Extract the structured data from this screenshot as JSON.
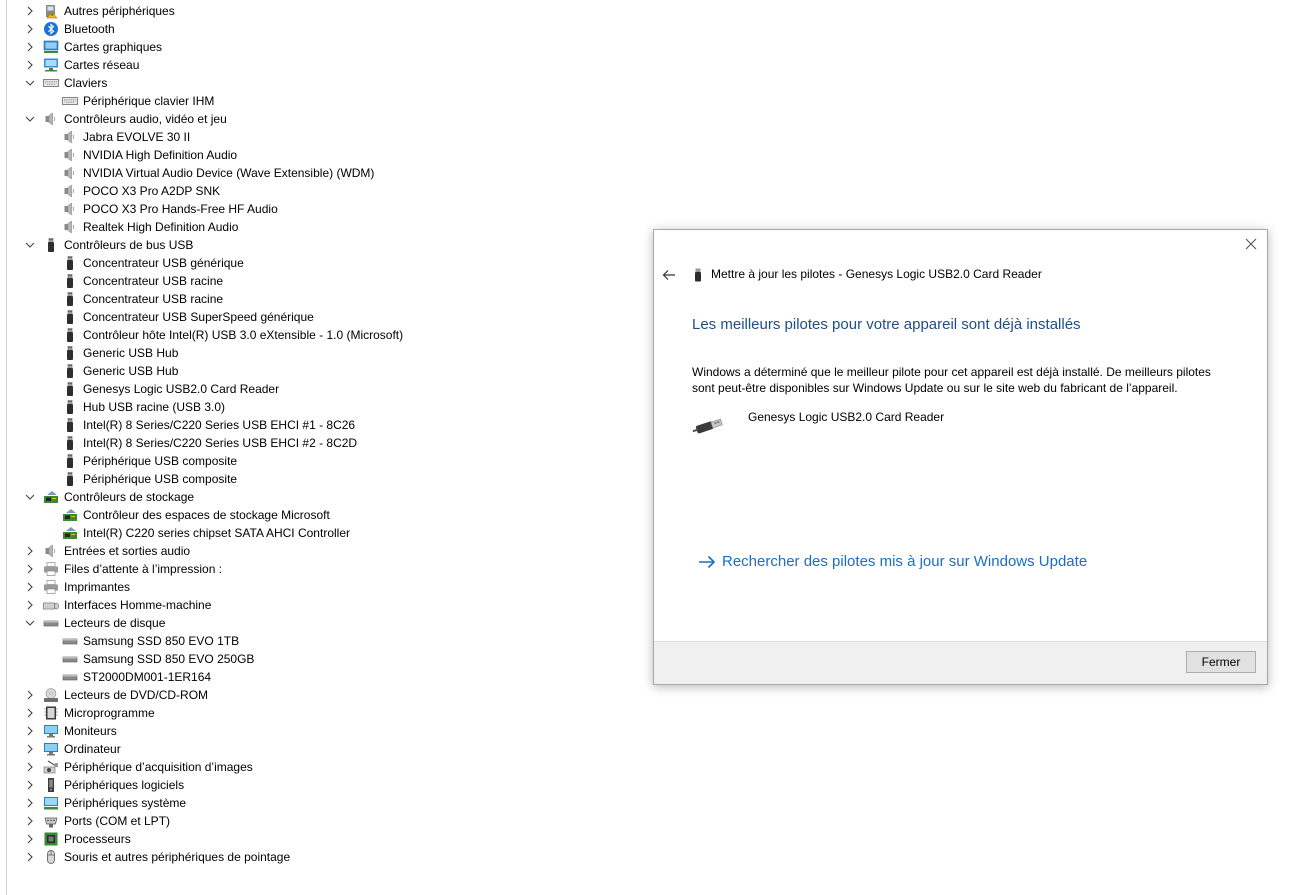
{
  "tree": [
    {
      "label": "Autres périphériques",
      "type": "cat",
      "expanded": false,
      "icon": "warning-device-icon"
    },
    {
      "label": "Bluetooth",
      "type": "cat",
      "expanded": false,
      "icon": "bluetooth-icon"
    },
    {
      "label": "Cartes graphiques",
      "type": "cat",
      "expanded": false,
      "icon": "display-adapter-icon"
    },
    {
      "label": "Cartes réseau",
      "type": "cat",
      "expanded": false,
      "icon": "network-adapter-icon"
    },
    {
      "label": "Claviers",
      "type": "cat",
      "expanded": true,
      "icon": "keyboard-icon"
    },
    {
      "label": "Périphérique clavier IHM",
      "type": "child",
      "icon": "keyboard-icon"
    },
    {
      "label": "Contrôleurs audio, vidéo et jeu",
      "type": "cat",
      "expanded": true,
      "icon": "speaker-icon"
    },
    {
      "label": "Jabra EVOLVE 30 II",
      "type": "child",
      "icon": "speaker-icon"
    },
    {
      "label": "NVIDIA High Definition Audio",
      "type": "child",
      "icon": "speaker-icon"
    },
    {
      "label": "NVIDIA Virtual Audio Device (Wave Extensible) (WDM)",
      "type": "child",
      "icon": "speaker-icon"
    },
    {
      "label": "POCO X3 Pro A2DP SNK",
      "type": "child",
      "icon": "speaker-icon"
    },
    {
      "label": "POCO X3 Pro Hands-Free HF Audio",
      "type": "child",
      "icon": "speaker-icon"
    },
    {
      "label": "Realtek High Definition Audio",
      "type": "child",
      "icon": "speaker-icon"
    },
    {
      "label": "Contrôleurs de bus USB",
      "type": "cat",
      "expanded": true,
      "icon": "usb-icon"
    },
    {
      "label": "Concentrateur USB générique",
      "type": "child",
      "icon": "usb-icon"
    },
    {
      "label": "Concentrateur USB racine",
      "type": "child",
      "icon": "usb-icon"
    },
    {
      "label": "Concentrateur USB racine",
      "type": "child",
      "icon": "usb-icon"
    },
    {
      "label": "Concentrateur USB SuperSpeed générique",
      "type": "child",
      "icon": "usb-icon"
    },
    {
      "label": "Contrôleur hôte Intel(R) USB 3.0 eXtensible - 1.0 (Microsoft)",
      "type": "child",
      "icon": "usb-icon"
    },
    {
      "label": "Generic USB Hub",
      "type": "child",
      "icon": "usb-icon"
    },
    {
      "label": "Generic USB Hub",
      "type": "child",
      "icon": "usb-icon"
    },
    {
      "label": "Genesys Logic USB2.0 Card Reader",
      "type": "child",
      "icon": "usb-icon"
    },
    {
      "label": "Hub USB racine (USB 3.0)",
      "type": "child",
      "icon": "usb-icon"
    },
    {
      "label": "Intel(R) 8 Series/C220 Series USB EHCI #1 - 8C26",
      "type": "child",
      "icon": "usb-icon"
    },
    {
      "label": "Intel(R) 8 Series/C220 Series USB EHCI #2 - 8C2D",
      "type": "child",
      "icon": "usb-icon"
    },
    {
      "label": "Périphérique USB composite",
      "type": "child",
      "icon": "usb-icon"
    },
    {
      "label": "Périphérique USB composite",
      "type": "child",
      "icon": "usb-icon"
    },
    {
      "label": "Contrôleurs de stockage",
      "type": "cat",
      "expanded": true,
      "icon": "storage-controller-icon"
    },
    {
      "label": "Contrôleur des espaces de stockage Microsoft",
      "type": "child",
      "icon": "storage-controller-icon"
    },
    {
      "label": "Intel(R) C220 series chipset SATA AHCI Controller",
      "type": "child",
      "icon": "storage-controller-icon"
    },
    {
      "label": "Entrées et sorties audio",
      "type": "cat",
      "expanded": false,
      "icon": "speaker-icon"
    },
    {
      "label": "Files d’attente à l’impression :",
      "type": "cat",
      "expanded": false,
      "icon": "printer-icon"
    },
    {
      "label": "Imprimantes",
      "type": "cat",
      "expanded": false,
      "icon": "printer-icon"
    },
    {
      "label": "Interfaces Homme-machine",
      "type": "cat",
      "expanded": false,
      "icon": "hid-icon"
    },
    {
      "label": "Lecteurs de disque",
      "type": "cat",
      "expanded": true,
      "icon": "disk-drive-icon"
    },
    {
      "label": "Samsung SSD 850 EVO 1TB",
      "type": "child",
      "icon": "disk-drive-icon"
    },
    {
      "label": "Samsung SSD 850 EVO 250GB",
      "type": "child",
      "icon": "disk-drive-icon"
    },
    {
      "label": "ST2000DM001-1ER164",
      "type": "child",
      "icon": "disk-drive-icon"
    },
    {
      "label": "Lecteurs de DVD/CD-ROM",
      "type": "cat",
      "expanded": false,
      "icon": "dvd-drive-icon"
    },
    {
      "label": "Microprogramme",
      "type": "cat",
      "expanded": false,
      "icon": "firmware-icon"
    },
    {
      "label": "Moniteurs",
      "type": "cat",
      "expanded": false,
      "icon": "monitor-icon"
    },
    {
      "label": "Ordinateur",
      "type": "cat",
      "expanded": false,
      "icon": "monitor-icon"
    },
    {
      "label": "Périphérique d’acquisition d’images",
      "type": "cat",
      "expanded": false,
      "icon": "camera-icon"
    },
    {
      "label": "Périphériques logiciels",
      "type": "cat",
      "expanded": false,
      "icon": "software-device-icon"
    },
    {
      "label": "Périphériques système",
      "type": "cat",
      "expanded": false,
      "icon": "system-device-icon"
    },
    {
      "label": "Ports (COM et LPT)",
      "type": "cat",
      "expanded": false,
      "icon": "port-icon"
    },
    {
      "label": "Processeurs",
      "type": "cat",
      "expanded": false,
      "icon": "processor-icon"
    },
    {
      "label": "Souris et autres périphériques de pointage",
      "type": "cat",
      "expanded": false,
      "icon": "mouse-icon"
    }
  ],
  "dialog": {
    "title": "Mettre à jour les pilotes - Genesys Logic USB2.0 Card Reader",
    "heading": "Les meilleurs pilotes pour votre appareil sont déjà installés",
    "description": "Windows a déterminé que le meilleur pilote pour cet appareil est déjà installé. De meilleurs pilotes sont peut-être disponibles sur Windows Update ou sur le site web du fabricant de l’appareil.",
    "device_name": "Genesys Logic USB2.0 Card Reader",
    "link_text": "Rechercher des pilotes mis à jour sur Windows Update",
    "close_button": "Fermer"
  },
  "colors": {
    "heading": "#1f4e8c",
    "link": "#1a6ec4",
    "footer_bg": "#f0f0f0"
  }
}
